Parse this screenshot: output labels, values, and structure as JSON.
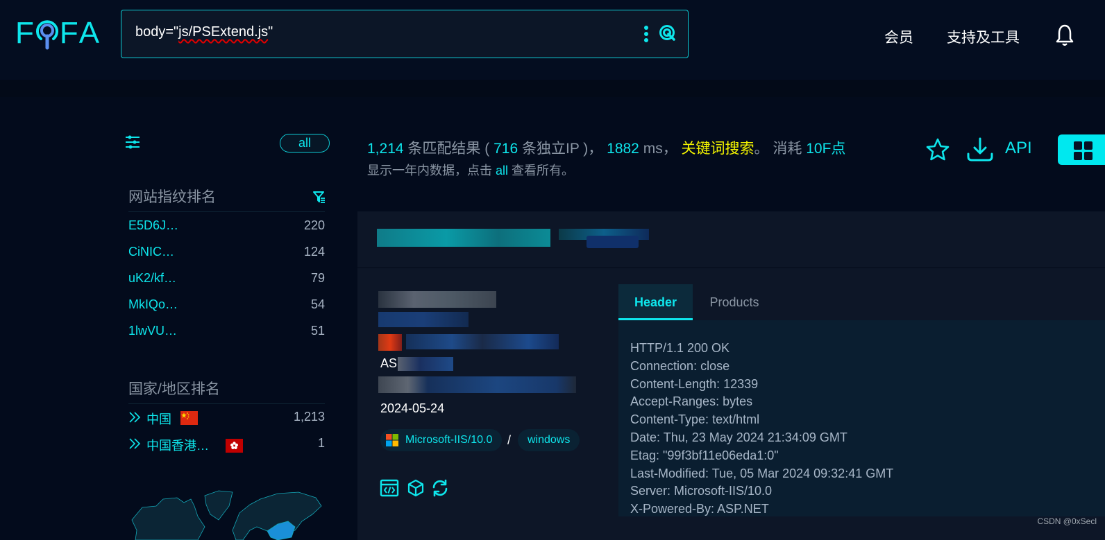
{
  "header": {
    "logo_letters": [
      "F",
      "F",
      "A"
    ],
    "search": {
      "value_prefix": "body=\"",
      "value_misspelled": "js/PSExtend.js",
      "value_suffix": "\""
    },
    "nav": [
      "会员",
      "支持及工具"
    ]
  },
  "sidebar": {
    "all_label": "all",
    "fingerprint_title": "网站指纹排名",
    "fingerprints": [
      {
        "name": "E5D6J…",
        "count": "220"
      },
      {
        "name": "CiNIC…",
        "count": "124"
      },
      {
        "name": "uK2/kf…",
        "count": "79"
      },
      {
        "name": "MkIQo…",
        "count": "54"
      },
      {
        "name": "1lwVU…",
        "count": "51"
      }
    ],
    "country_title": "国家/地区排名",
    "countries": [
      {
        "name": "中国",
        "count": "1,213",
        "flag": "cn",
        "flag_color": "#de2910"
      },
      {
        "name": "中国香港…",
        "count": "1",
        "flag": "hk",
        "flag_color": "#de0000"
      }
    ]
  },
  "results": {
    "total": "1,214",
    "total_label": "条匹配结果",
    "paren_open": "(",
    "unique_ip": "716",
    "unique_ip_label": "条独立IP",
    "paren_close": ")，",
    "time_ms": "1882",
    "time_unit": "ms，",
    "search_type": "关键词搜索",
    "period": "。",
    "cost_label": "消耗",
    "cost": "10F点",
    "sub_prefix": "显示一年内数据，点击",
    "sub_all": "all",
    "sub_suffix": "查看所有。",
    "api_label": "API"
  },
  "result_card": {
    "date": "2024-05-24",
    "as_prefix": "AS",
    "server_tag": "Microsoft-IIS/10.0",
    "separator": "/",
    "os_tag": "windows",
    "tabs": [
      {
        "label": "Header",
        "active": true
      },
      {
        "label": "Products",
        "active": false
      }
    ],
    "header_lines": [
      "HTTP/1.1 200 OK",
      "Connection: close",
      "Content-Length: 12339",
      "Accept-Ranges: bytes",
      "Content-Type: text/html",
      "Date: Thu, 23 May 2024 21:34:09 GMT",
      "Etag: \"99f3bf11e06eda1:0\"",
      "Last-Modified: Tue, 05 Mar 2024 09:32:41 GMT",
      "Server: Microsoft-IIS/10.0",
      "X-Powered-By: ASP.NET"
    ]
  },
  "watermark": "CSDN @0xSecl",
  "colors": {
    "accent": "#0ee6ec",
    "highlight": "#f3f300",
    "background": "#030b1c",
    "card": "#0d1627"
  }
}
